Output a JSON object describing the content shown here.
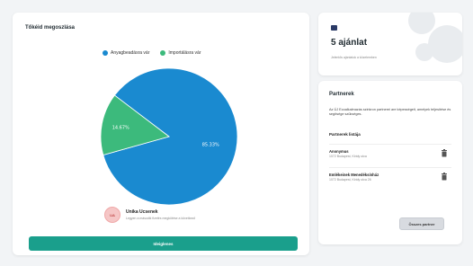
{
  "stats": {
    "title": "Tőkéid megoszlása",
    "legend": [
      {
        "label": "Anyagbeadásra vár",
        "color": "#1a8ad0"
      },
      {
        "label": "Importálásra vár",
        "color": "#3cba7c"
      }
    ],
    "user": {
      "initials": "UA",
      "name": "Unika Ucsenek",
      "subtitle": "Legyen a második fizetés megkötése a következő"
    },
    "primary_button": "Ideiglenes"
  },
  "chart_data": {
    "type": "pie",
    "slices": [
      {
        "label": "85.33%",
        "value": 85.33,
        "color": "#1a8ad0"
      },
      {
        "label": "14.67%",
        "value": 14.67,
        "color": "#3cba7c"
      }
    ]
  },
  "offer": {
    "icon": "envelope-icon",
    "title": "5 ajánlat",
    "subtitle": "Jelentős ajánlatok a közelemben"
  },
  "partners": {
    "title": "Partnerek",
    "description": "Az ÚJ Ecoalkalmazás szinkron partnerei are képességeit, amelyek teljesítése és segítsége szükséges.",
    "subtitle": "Partnerek listája",
    "items": [
      {
        "name": "Anonymus",
        "address": "1072 Budapest, Király utca"
      },
      {
        "name": "Emlékeinek Menedéksínház",
        "address": "1072 Budapest, Király utca 26"
      }
    ],
    "button": "Összes partner"
  }
}
